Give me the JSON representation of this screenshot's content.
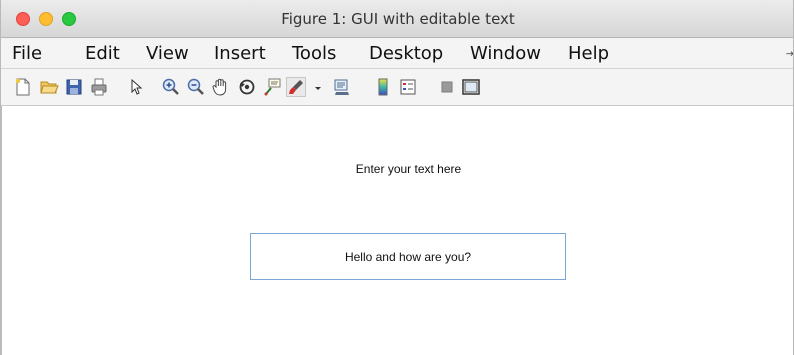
{
  "window": {
    "title": "Figure 1: GUI with editable text"
  },
  "menubar": {
    "items": [
      "File",
      "Edit",
      "View",
      "Insert",
      "Tools",
      "Desktop",
      "Window",
      "Help"
    ],
    "overflow_glyph": "⇥"
  },
  "toolbar": {
    "icons": [
      "new-figure-icon",
      "open-file-icon",
      "save-icon",
      "print-icon",
      "edit-plot-arrow-icon",
      "zoom-in-icon",
      "zoom-out-icon",
      "pan-hand-icon",
      "rotate-3d-icon",
      "data-cursor-icon",
      "brush-icon",
      "brush-dropdown-icon",
      "link-plot-icon",
      "colorbar-icon",
      "legend-icon",
      "hide-plot-tools-icon",
      "show-plot-tools-icon"
    ]
  },
  "content": {
    "prompt_text": "Enter your text here",
    "edit_value": "Hello and how are you?"
  },
  "colors": {
    "close": "#fd5f57",
    "minimize": "#febd2e",
    "maximize": "#28c940",
    "edit_border": "#7aa7d6"
  }
}
